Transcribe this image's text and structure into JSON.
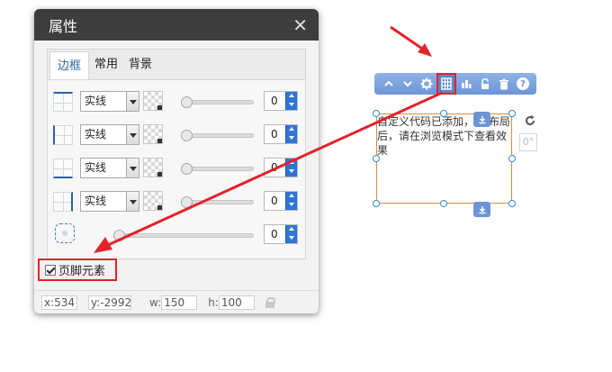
{
  "panel": {
    "title": "属性",
    "close_label": "✕",
    "tabs": [
      {
        "label": "边框",
        "active": true
      },
      {
        "label": "常用",
        "active": false
      },
      {
        "label": "背景",
        "active": false
      }
    ],
    "border_rows": [
      {
        "side": "top",
        "style": "实线",
        "width": "0"
      },
      {
        "side": "left",
        "style": "实线",
        "width": "0"
      },
      {
        "side": "bottom",
        "style": "实线",
        "width": "0"
      },
      {
        "side": "right",
        "style": "实线",
        "width": "0"
      }
    ],
    "radius_value": "0",
    "footer_checkbox_label": "页脚元素",
    "coords": {
      "x": "x:534",
      "y": "y:-2992",
      "w_label": "w:",
      "w": "150",
      "h_label": "h:",
      "h": "100"
    }
  },
  "element": {
    "text": "自定义代码已添加，    排布局后，请在浏览模式下查看效果",
    "angle": "0°"
  },
  "toolbar": {
    "help_label": "?"
  },
  "colors": {
    "annotation_red": "#e2232a",
    "toolbar_blue": "#6d95d6",
    "panel_header": "#3d3d3d"
  }
}
